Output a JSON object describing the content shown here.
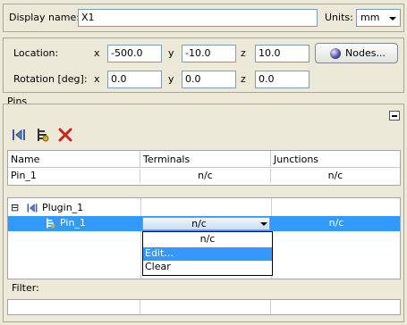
{
  "general": {
    "display_name_label": "Display name:",
    "display_name_value": "X1",
    "units_label": "Units:",
    "units_value": "mm"
  },
  "transform": {
    "location_label": "Location:",
    "rotation_label": "Rotation [deg]:",
    "axis_x": "x",
    "axis_y": "y",
    "axis_z": "z",
    "location": {
      "x": "-500.0",
      "y": "-10.0",
      "z": "10.0"
    },
    "rotation": {
      "x": "0.0",
      "y": "0.0",
      "z": "0.0"
    },
    "nodes_button": "Nodes..."
  },
  "pins": {
    "section_label": "Pins",
    "collapse_symbol": "−",
    "columns": [
      "Name",
      "Terminals",
      "Junctions"
    ],
    "rows": [
      {
        "name": "Pin_1",
        "terminals": "n/c",
        "junctions": "n/c"
      }
    ],
    "tree": {
      "expander": "⊟",
      "plugin": "Plugin_1",
      "pin": "Pin_1",
      "pin_terminals": "n/c",
      "pin_junctions": "n/c"
    },
    "dropdown_options": [
      "n/c",
      "Edit...",
      "Clear"
    ],
    "dropdown_highlighted": "Edit...",
    "filter_label": "Filter:"
  },
  "colors": {
    "selection": "#3399ff",
    "delete": "#cc2222"
  }
}
